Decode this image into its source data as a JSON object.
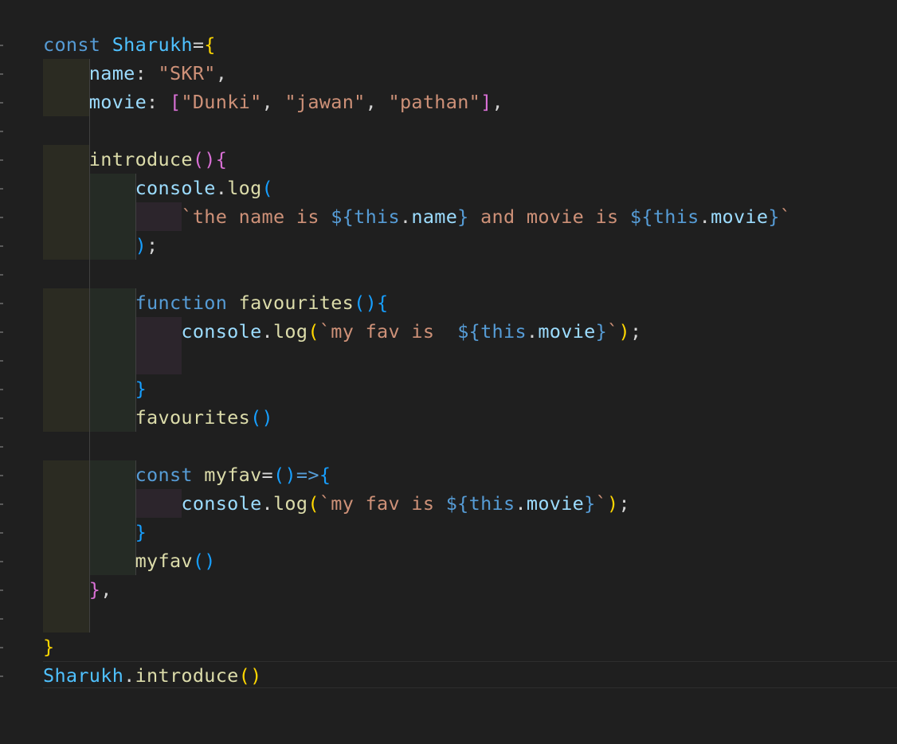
{
  "editor": {
    "language": "javascript",
    "lines": [
      [
        {
          "t": "const ",
          "c": "kw"
        },
        {
          "t": "Sharukh",
          "c": "cst"
        },
        {
          "t": "=",
          "c": "pun"
        },
        {
          "t": "{",
          "c": "br1"
        }
      ],
      [
        {
          "t": "    ",
          "c": "pun"
        },
        {
          "t": "name",
          "c": "var"
        },
        {
          "t": ": ",
          "c": "pun"
        },
        {
          "t": "\"SKR\"",
          "c": "str"
        },
        {
          "t": ",",
          "c": "pun"
        }
      ],
      [
        {
          "t": "    ",
          "c": "pun"
        },
        {
          "t": "movie",
          "c": "var"
        },
        {
          "t": ": ",
          "c": "pun"
        },
        {
          "t": "[",
          "c": "br2"
        },
        {
          "t": "\"Dunki\"",
          "c": "str"
        },
        {
          "t": ", ",
          "c": "pun"
        },
        {
          "t": "\"jawan\"",
          "c": "str"
        },
        {
          "t": ", ",
          "c": "pun"
        },
        {
          "t": "\"pathan\"",
          "c": "str"
        },
        {
          "t": "]",
          "c": "br2"
        },
        {
          "t": ",",
          "c": "pun"
        }
      ],
      [],
      [
        {
          "t": "    ",
          "c": "pun"
        },
        {
          "t": "introduce",
          "c": "fn"
        },
        {
          "t": "()",
          "c": "br2"
        },
        {
          "t": "{",
          "c": "br2"
        }
      ],
      [
        {
          "t": "        ",
          "c": "pun"
        },
        {
          "t": "console",
          "c": "var"
        },
        {
          "t": ".",
          "c": "pun"
        },
        {
          "t": "log",
          "c": "fn"
        },
        {
          "t": "(",
          "c": "br3"
        }
      ],
      [
        {
          "t": "            ",
          "c": "pun"
        },
        {
          "t": "`the name is ",
          "c": "str"
        },
        {
          "t": "${",
          "c": "kw"
        },
        {
          "t": "this",
          "c": "kw"
        },
        {
          "t": ".",
          "c": "pun"
        },
        {
          "t": "name",
          "c": "var"
        },
        {
          "t": "}",
          "c": "kw"
        },
        {
          "t": " and movie is ",
          "c": "str"
        },
        {
          "t": "${",
          "c": "kw"
        },
        {
          "t": "this",
          "c": "kw"
        },
        {
          "t": ".",
          "c": "pun"
        },
        {
          "t": "movie",
          "c": "var"
        },
        {
          "t": "}",
          "c": "kw"
        },
        {
          "t": "`",
          "c": "str"
        }
      ],
      [
        {
          "t": "        ",
          "c": "pun"
        },
        {
          "t": ")",
          "c": "br3"
        },
        {
          "t": ";",
          "c": "pun"
        }
      ],
      [],
      [
        {
          "t": "        ",
          "c": "pun"
        },
        {
          "t": "function ",
          "c": "kw"
        },
        {
          "t": "favourites",
          "c": "fn"
        },
        {
          "t": "(){",
          "c": "br3"
        }
      ],
      [
        {
          "t": "            ",
          "c": "pun"
        },
        {
          "t": "console",
          "c": "var"
        },
        {
          "t": ".",
          "c": "pun"
        },
        {
          "t": "log",
          "c": "fn"
        },
        {
          "t": "(",
          "c": "br1"
        },
        {
          "t": "`my fav is  ",
          "c": "str"
        },
        {
          "t": "${",
          "c": "kw"
        },
        {
          "t": "this",
          "c": "kw"
        },
        {
          "t": ".",
          "c": "pun"
        },
        {
          "t": "movie",
          "c": "var"
        },
        {
          "t": "}",
          "c": "kw"
        },
        {
          "t": "`",
          "c": "str"
        },
        {
          "t": ")",
          "c": "br1"
        },
        {
          "t": ";",
          "c": "pun"
        }
      ],
      [],
      [
        {
          "t": "        ",
          "c": "pun"
        },
        {
          "t": "}",
          "c": "br3"
        }
      ],
      [
        {
          "t": "        ",
          "c": "pun"
        },
        {
          "t": "favourites",
          "c": "fn"
        },
        {
          "t": "()",
          "c": "br3"
        }
      ],
      [],
      [
        {
          "t": "        ",
          "c": "pun"
        },
        {
          "t": "const ",
          "c": "kw"
        },
        {
          "t": "myfav",
          "c": "fn"
        },
        {
          "t": "=",
          "c": "pun"
        },
        {
          "t": "()",
          "c": "br3"
        },
        {
          "t": "=>",
          "c": "kw"
        },
        {
          "t": "{",
          "c": "br3"
        }
      ],
      [
        {
          "t": "            ",
          "c": "pun"
        },
        {
          "t": "console",
          "c": "var"
        },
        {
          "t": ".",
          "c": "pun"
        },
        {
          "t": "log",
          "c": "fn"
        },
        {
          "t": "(",
          "c": "br1"
        },
        {
          "t": "`my fav is ",
          "c": "str"
        },
        {
          "t": "${",
          "c": "kw"
        },
        {
          "t": "this",
          "c": "kw"
        },
        {
          "t": ".",
          "c": "pun"
        },
        {
          "t": "movie",
          "c": "var"
        },
        {
          "t": "}",
          "c": "kw"
        },
        {
          "t": "`",
          "c": "str"
        },
        {
          "t": ")",
          "c": "br1"
        },
        {
          "t": ";",
          "c": "pun"
        }
      ],
      [
        {
          "t": "        ",
          "c": "pun"
        },
        {
          "t": "}",
          "c": "br3"
        }
      ],
      [
        {
          "t": "        ",
          "c": "pun"
        },
        {
          "t": "myfav",
          "c": "fn"
        },
        {
          "t": "()",
          "c": "br3"
        }
      ],
      [
        {
          "t": "    ",
          "c": "pun"
        },
        {
          "t": "}",
          "c": "br2"
        },
        {
          "t": ",",
          "c": "pun"
        }
      ],
      [],
      [
        {
          "t": "}",
          "c": "br1"
        }
      ],
      [
        {
          "t": "Sharukh",
          "c": "cst"
        },
        {
          "t": ".",
          "c": "pun"
        },
        {
          "t": "introduce",
          "c": "fn"
        },
        {
          "t": "()",
          "c": "br1"
        }
      ]
    ]
  },
  "colors": {
    "background": "#1f1f1f",
    "keyword": "#569cd6",
    "string": "#ce9178",
    "function": "#dcdcaa",
    "variable": "#9cdcfe",
    "bracket_level1": "#ffd700",
    "bracket_level2": "#da70d6",
    "bracket_level3": "#179fff"
  }
}
